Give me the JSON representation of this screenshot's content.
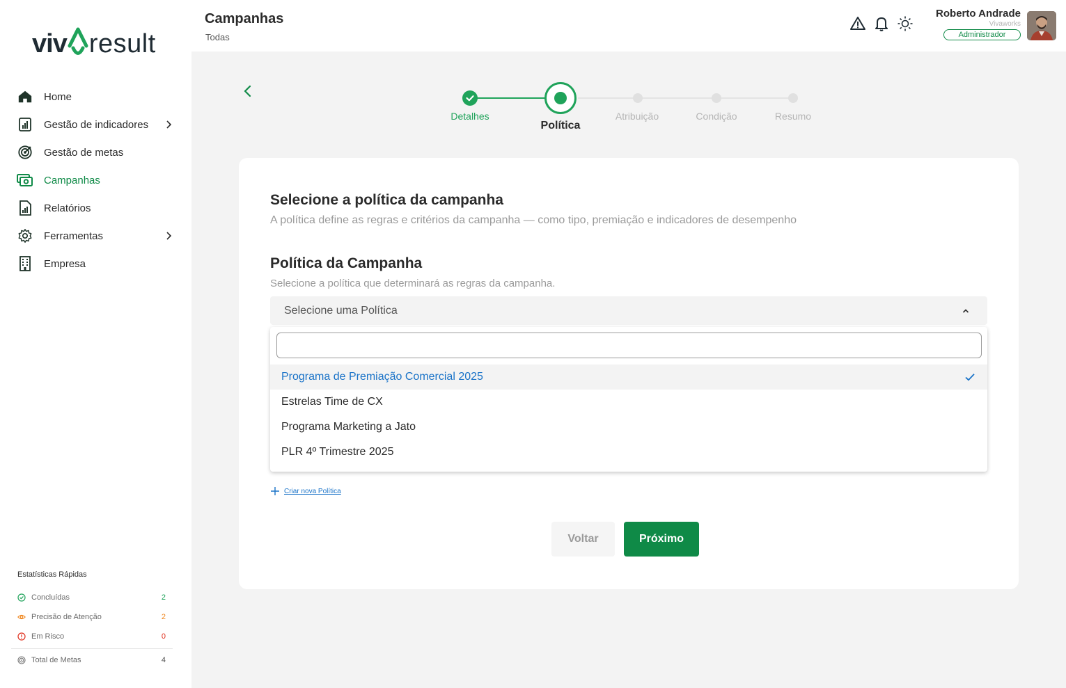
{
  "brand": {
    "logo_left": "viv",
    "logo_right": "result",
    "accent": "#0f8a47",
    "link": "#1a73c8"
  },
  "sidebar": {
    "items": [
      {
        "label": "Home",
        "icon": "home-icon"
      },
      {
        "label": "Gestão de indicadores",
        "icon": "bar-chart-icon",
        "has_submenu": true
      },
      {
        "label": "Gestão de metas",
        "icon": "target-icon"
      },
      {
        "label": "Campanhas",
        "icon": "money-icon",
        "active": true
      },
      {
        "label": "Relatórios",
        "icon": "report-icon"
      },
      {
        "label": "Ferramentas",
        "icon": "gear-icon",
        "has_submenu": true
      },
      {
        "label": "Empresa",
        "icon": "building-icon"
      }
    ],
    "stats": {
      "title": "Estatísticas Rápidas",
      "rows": [
        {
          "label": "Concluídas",
          "value": "2",
          "color": "#1fa35a",
          "icon": "check-circle-icon"
        },
        {
          "label": "Precisão de Atenção",
          "value": "2",
          "color": "#f08a24",
          "icon": "eye-icon"
        },
        {
          "label": "Em Risco",
          "value": "0",
          "color": "#e0301e",
          "icon": "alert-circle-icon"
        }
      ],
      "total": {
        "label": "Total de Metas",
        "value": "4",
        "color": "#555555",
        "icon": "target-icon"
      }
    }
  },
  "header": {
    "title": "Campanhas",
    "subtitle": "Todas",
    "user": {
      "name": "Roberto Andrade",
      "company": "Vivaworks",
      "role": "Administrador"
    }
  },
  "stepper": {
    "steps": [
      {
        "label": "Detalhes",
        "state": "done"
      },
      {
        "label": "Política",
        "state": "current"
      },
      {
        "label": "Atribuição",
        "state": "pending"
      },
      {
        "label": "Condição",
        "state": "pending"
      },
      {
        "label": "Resumo",
        "state": "pending"
      }
    ]
  },
  "card": {
    "section_title": "Selecione a política da campanha",
    "section_desc": "A política define as regras e critérios da campanha — como tipo, premiação e indicadores de desempenho",
    "field_title": "Política da Campanha",
    "field_desc": "Selecione a política que determinará as regras da campanha.",
    "select_placeholder": "Selecione uma Política",
    "search_value": "",
    "options": [
      {
        "label": "Programa de Premiação Comercial 2025",
        "selected": true
      },
      {
        "label": "Estrelas Time de CX"
      },
      {
        "label": "Programa Marketing a Jato"
      },
      {
        "label": "PLR 4º Trimestre 2025"
      }
    ],
    "create_link": "Criar nova Política",
    "back_label": "Voltar",
    "next_label": "Próximo"
  }
}
